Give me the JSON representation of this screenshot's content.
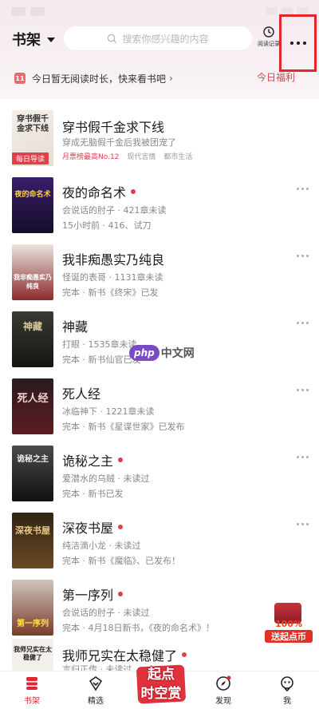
{
  "header": {
    "shelf_title": "书架",
    "search_placeholder": "搜索你感兴趣的内容",
    "history_label": "阅读记录"
  },
  "notice": {
    "calendar_day": "11",
    "text": "今日暂无阅读时长，快来看书吧",
    "chevron": "›",
    "welfare": "今日福利"
  },
  "featured": {
    "title": "穿书假千金求下线",
    "subtitle": "穿成无脑假千金后我被团宠了",
    "badge": "每日导读",
    "rank": "月票榜最高No.12",
    "tag1": "现代言情",
    "tag2": "都市生活",
    "cover_text": "穿书假千金求下线"
  },
  "books": [
    {
      "title": "夜的命名术",
      "author_line": "会说话的肘子 · 421章未读",
      "status_line": "15小时前 · 416、试刀",
      "cover_text": "夜的命名术",
      "has_dot": true
    },
    {
      "title": "我非痴愚实乃纯良",
      "author_line": "怪诞的表哥 · 1131章未读",
      "status_line": "完本 · 新书《终宋》已发",
      "cover_text": "我非痴愚实乃纯良",
      "has_dot": false
    },
    {
      "title": "神藏",
      "author_line": "打眼 · 1535章未读",
      "status_line": "完本 · 新书仙官已发",
      "cover_text": "神藏",
      "has_dot": false
    },
    {
      "title": "死人经",
      "author_line": "冰临神下 · 1221章未读",
      "status_line": "完本 · 新书《星谍世家》已发布",
      "cover_text": "死人经",
      "has_dot": false
    },
    {
      "title": "诡秘之主",
      "author_line": "爱潜水的乌贼 · 未读过",
      "status_line": "完本 · 新书已发",
      "cover_text": "诡秘之主",
      "has_dot": true
    },
    {
      "title": "深夜书屋",
      "author_line": "纯洁滴小龙 · 未读过",
      "status_line": "完本 · 新书《魔临》、已发布！",
      "cover_text": "深夜书屋",
      "has_dot": true
    },
    {
      "title": "第一序列",
      "author_line": "会说话的肘子 · 未读过",
      "status_line": "完本 · 4月18日新书，《夜的命名术》！",
      "cover_text": "第一序列",
      "has_dot": true
    },
    {
      "title": "我师兄实在太稳健了",
      "author_line": "言归正传 · 未读过",
      "status_line": "",
      "cover_text": "我师兄实在太稳健了",
      "has_dot": true
    }
  ],
  "watermark": {
    "logo": "php",
    "text": "中文网"
  },
  "promo": {
    "line1": "100%",
    "line2": "送起点币"
  },
  "nav": {
    "shelf": "书架",
    "featured": "精选",
    "center_line1": "起点",
    "center_line2": "时空赏",
    "discover": "发现",
    "me": "我"
  },
  "colors": {
    "accent": "#e0262f",
    "dot": "#e0404a",
    "welfare": "#d4454b"
  }
}
